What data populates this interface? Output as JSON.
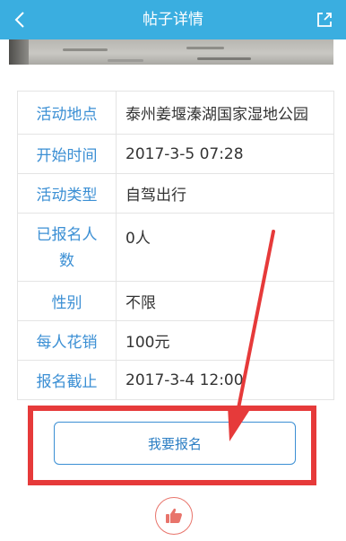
{
  "header": {
    "title": "帖子详情",
    "back_icon": "chevron-left-icon",
    "share_icon": "share-icon",
    "background": "#3aaee0"
  },
  "details": [
    {
      "label": "活动地点",
      "value": "泰州姜堰溱湖国家湿地公园"
    },
    {
      "label": "开始时间",
      "value": "2017-3-5 07:28"
    },
    {
      "label": "活动类型",
      "value": "自驾出行"
    },
    {
      "label": "已报名人数",
      "label_line1": "已报名人",
      "label_line2": "数",
      "value": "0人"
    },
    {
      "label": "性别",
      "value": "不限"
    },
    {
      "label": "每人花销",
      "value": "100元"
    },
    {
      "label": "报名截止",
      "value": "2017-3-4 12:00"
    }
  ],
  "actions": {
    "signup_label": "我要报名",
    "like_icon": "thumbs-up-icon"
  },
  "colors": {
    "accent": "#3b8fd4",
    "highlight": "#e63a3a",
    "like": "#e8746b"
  }
}
